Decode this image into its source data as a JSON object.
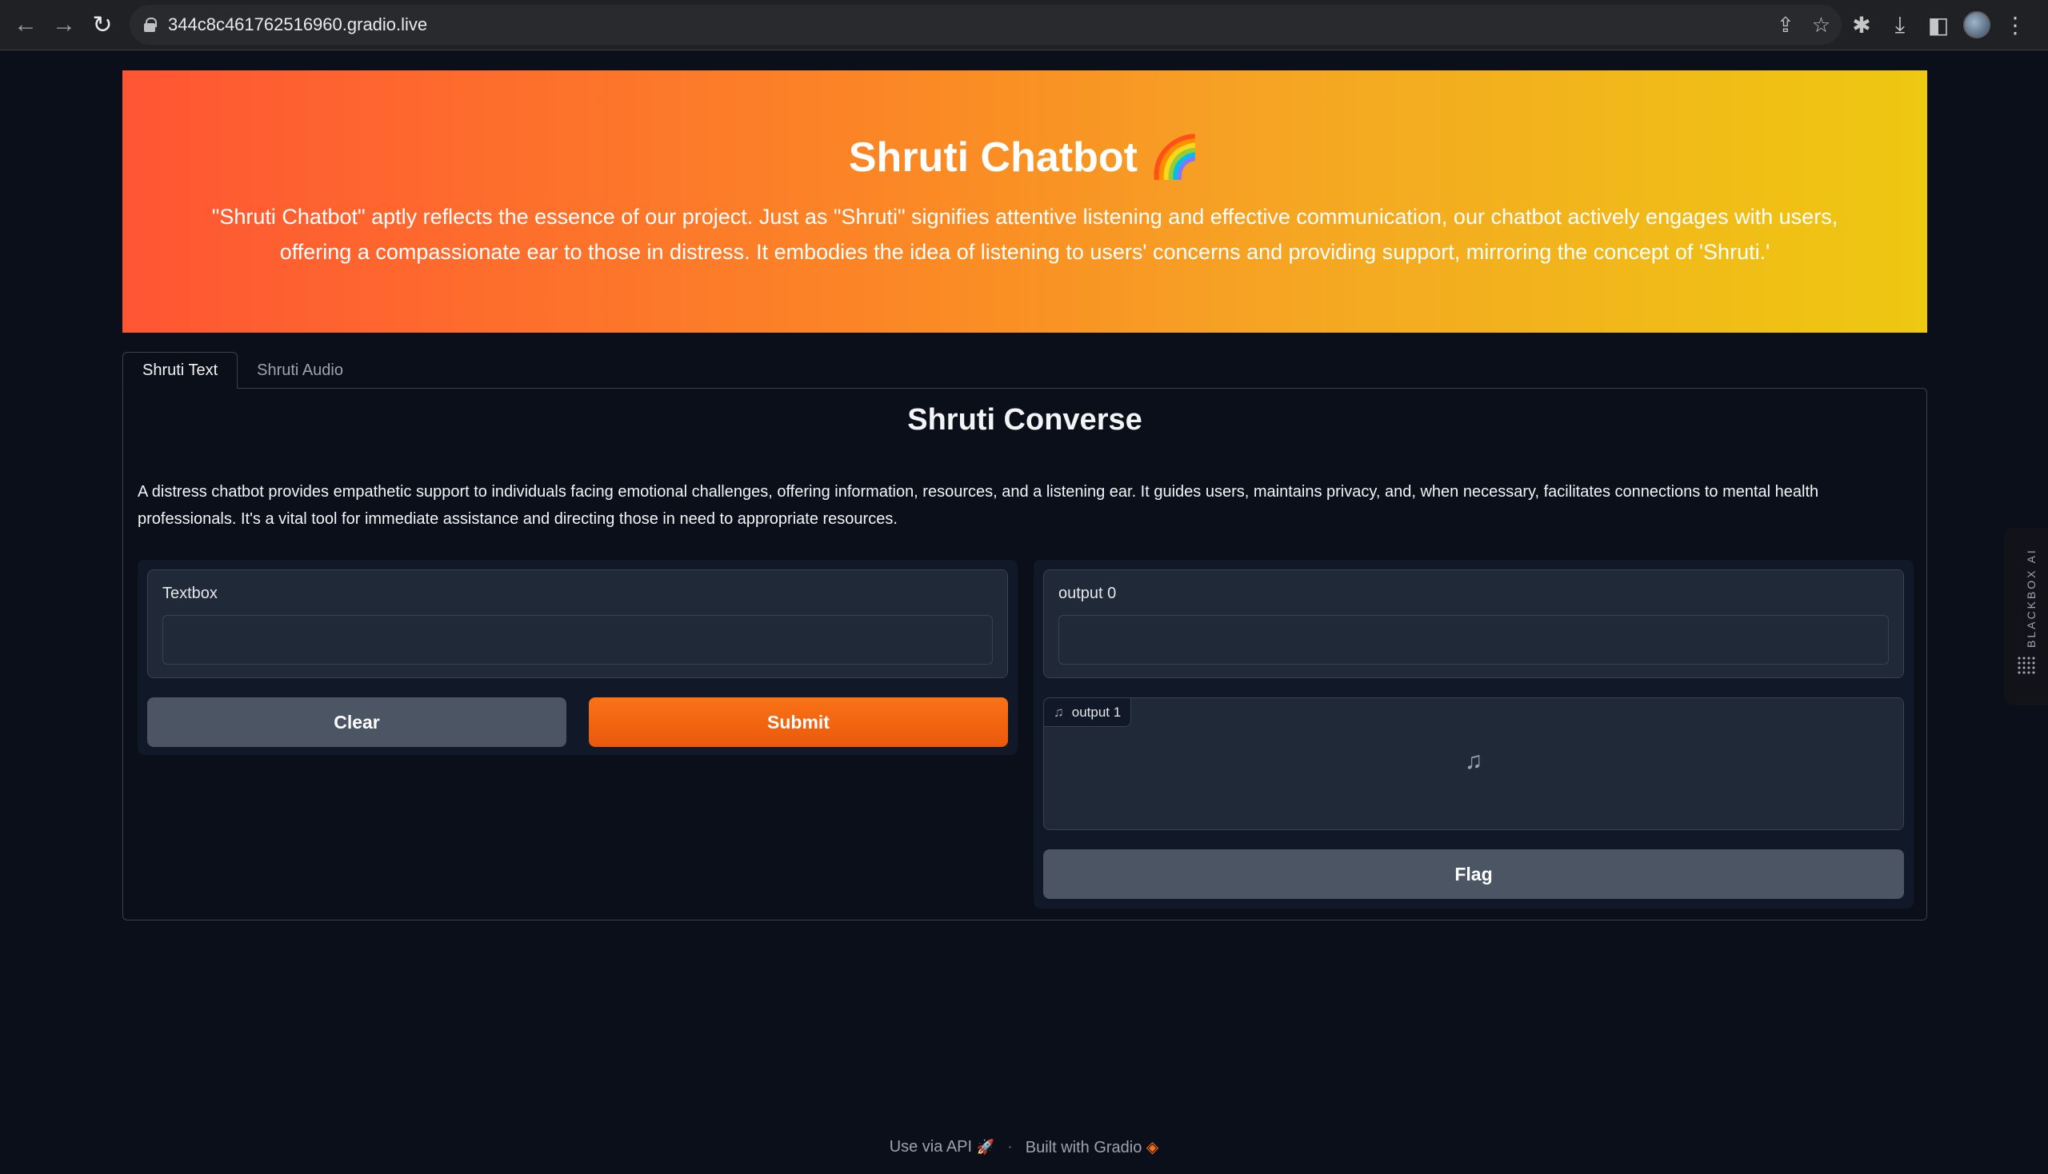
{
  "browser": {
    "url": "344c8c461762516960.gradio.live",
    "icons": {
      "back": "arrow-left-icon",
      "forward": "arrow-right-icon",
      "reload": "reload-icon",
      "share": "share-icon",
      "bookmark": "star-icon",
      "extensions": "puzzle-icon",
      "download": "download-icon",
      "sidepanel": "sidepanel-icon",
      "menu": "kebab-menu-icon"
    }
  },
  "header": {
    "title": "Shruti Chatbot 🌈",
    "description": "\"Shruti Chatbot\" aptly reflects the essence of our project. Just as \"Shruti\" signifies attentive listening and effective communication, our chatbot actively engages with users, offering a compassionate ear to those in distress. It embodies the idea of listening to users' concerns and providing support, mirroring the concept of 'Shruti.'",
    "gradient": [
      "#ff5533",
      "#eec811"
    ]
  },
  "tabs": [
    {
      "label": "Shruti Text",
      "selected": true
    },
    {
      "label": "Shruti Audio",
      "selected": false
    }
  ],
  "interface": {
    "title": "Shruti Converse",
    "description": "A distress chatbot provides empathetic support to individuals facing emotional challenges, offering information, resources, and a listening ear. It guides users, maintains privacy, and, when necessary, facilitates connections to mental health professionals. It's a vital tool for immediate assistance and directing those in need to appropriate resources.",
    "input": {
      "label": "Textbox",
      "value": "",
      "placeholder": ""
    },
    "clear_label": "Clear",
    "submit_label": "Submit",
    "output_text": {
      "label": "output 0",
      "value": ""
    },
    "output_audio": {
      "label": "output 1",
      "icon": "music-note-icon"
    },
    "flag_label": "Flag",
    "accent": "#f97316"
  },
  "side_tab": {
    "label": "BLACKBOX AI"
  },
  "footer": {
    "api_link": "Use via API",
    "separator": "·",
    "built_with": "Built with Gradio"
  }
}
